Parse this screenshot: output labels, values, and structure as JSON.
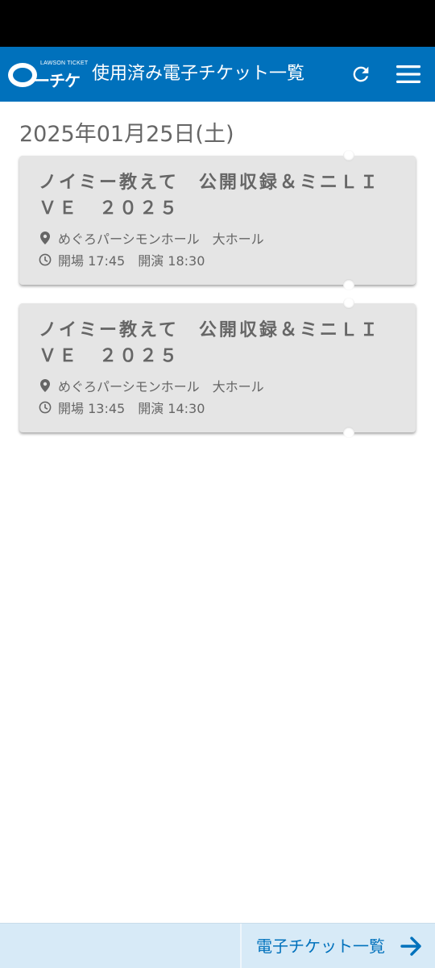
{
  "header": {
    "logo_small": "LAWSON TICKET",
    "logo_text": "ーチケ",
    "title": "使用済み電子チケット一覧",
    "refresh_icon": "refresh-icon",
    "menu_icon": "hamburger-menu-icon"
  },
  "date_heading": "2025年01月25日(土)",
  "tickets": [
    {
      "title": "ノイミー教えて　公開収録＆ミニＬＩＶＥ　２０２５",
      "venue": "めぐろパーシモンホール　大ホール",
      "time": "開場 17:45　開演 18:30"
    },
    {
      "title": "ノイミー教えて　公開収録＆ミニＬＩＶＥ　２０２５",
      "venue": "めぐろパーシモンホール　大ホール",
      "time": "開場 13:45　開演 14:30"
    }
  ],
  "footer": {
    "link_label": "電子チケット一覧",
    "arrow_icon": "arrow-right-icon"
  },
  "colors": {
    "brand": "#0071bc",
    "ticket_bg": "#e5e5e5",
    "footer_bg": "#d7eaf7"
  }
}
